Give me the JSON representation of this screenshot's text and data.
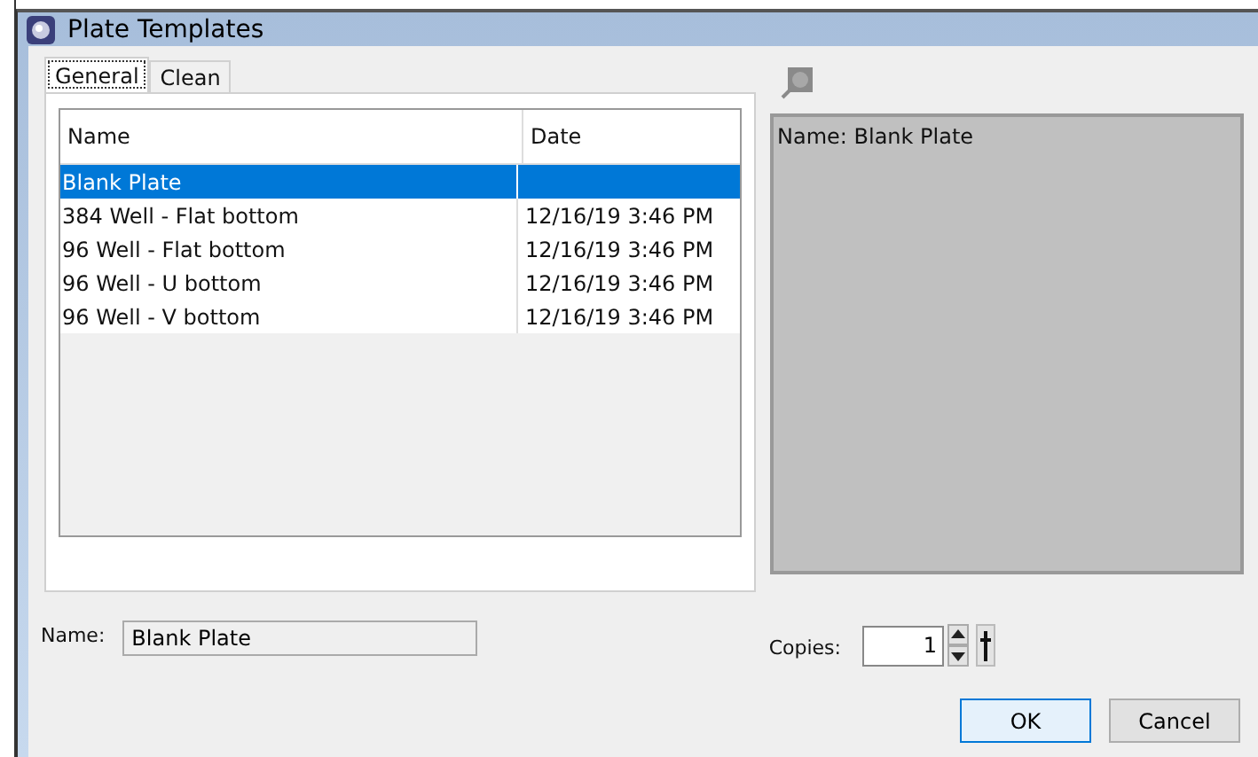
{
  "window": {
    "title": "Plate Templates"
  },
  "tabs": [
    {
      "label": "General",
      "selected": true
    },
    {
      "label": "Clean",
      "selected": false
    }
  ],
  "table": {
    "columns": [
      "Name",
      "Date"
    ],
    "rows": [
      {
        "name": "Blank Plate",
        "date": "",
        "selected": true
      },
      {
        "name": "384 Well - Flat bottom",
        "date": "12/16/19 3:46 PM",
        "selected": false
      },
      {
        "name": "96 Well - Flat bottom",
        "date": "12/16/19 3:46 PM",
        "selected": false
      },
      {
        "name": "96 Well - U bottom",
        "date": "12/16/19 3:46 PM",
        "selected": false
      },
      {
        "name": "96 Well - V bottom",
        "date": "12/16/19 3:46 PM",
        "selected": false
      }
    ]
  },
  "preview": {
    "text": "Name: Blank Plate"
  },
  "name_field": {
    "label": "Name:",
    "value": "Blank Plate"
  },
  "copies": {
    "label": "Copies:",
    "value": "1"
  },
  "buttons": [
    "OK",
    "Cancel"
  ]
}
